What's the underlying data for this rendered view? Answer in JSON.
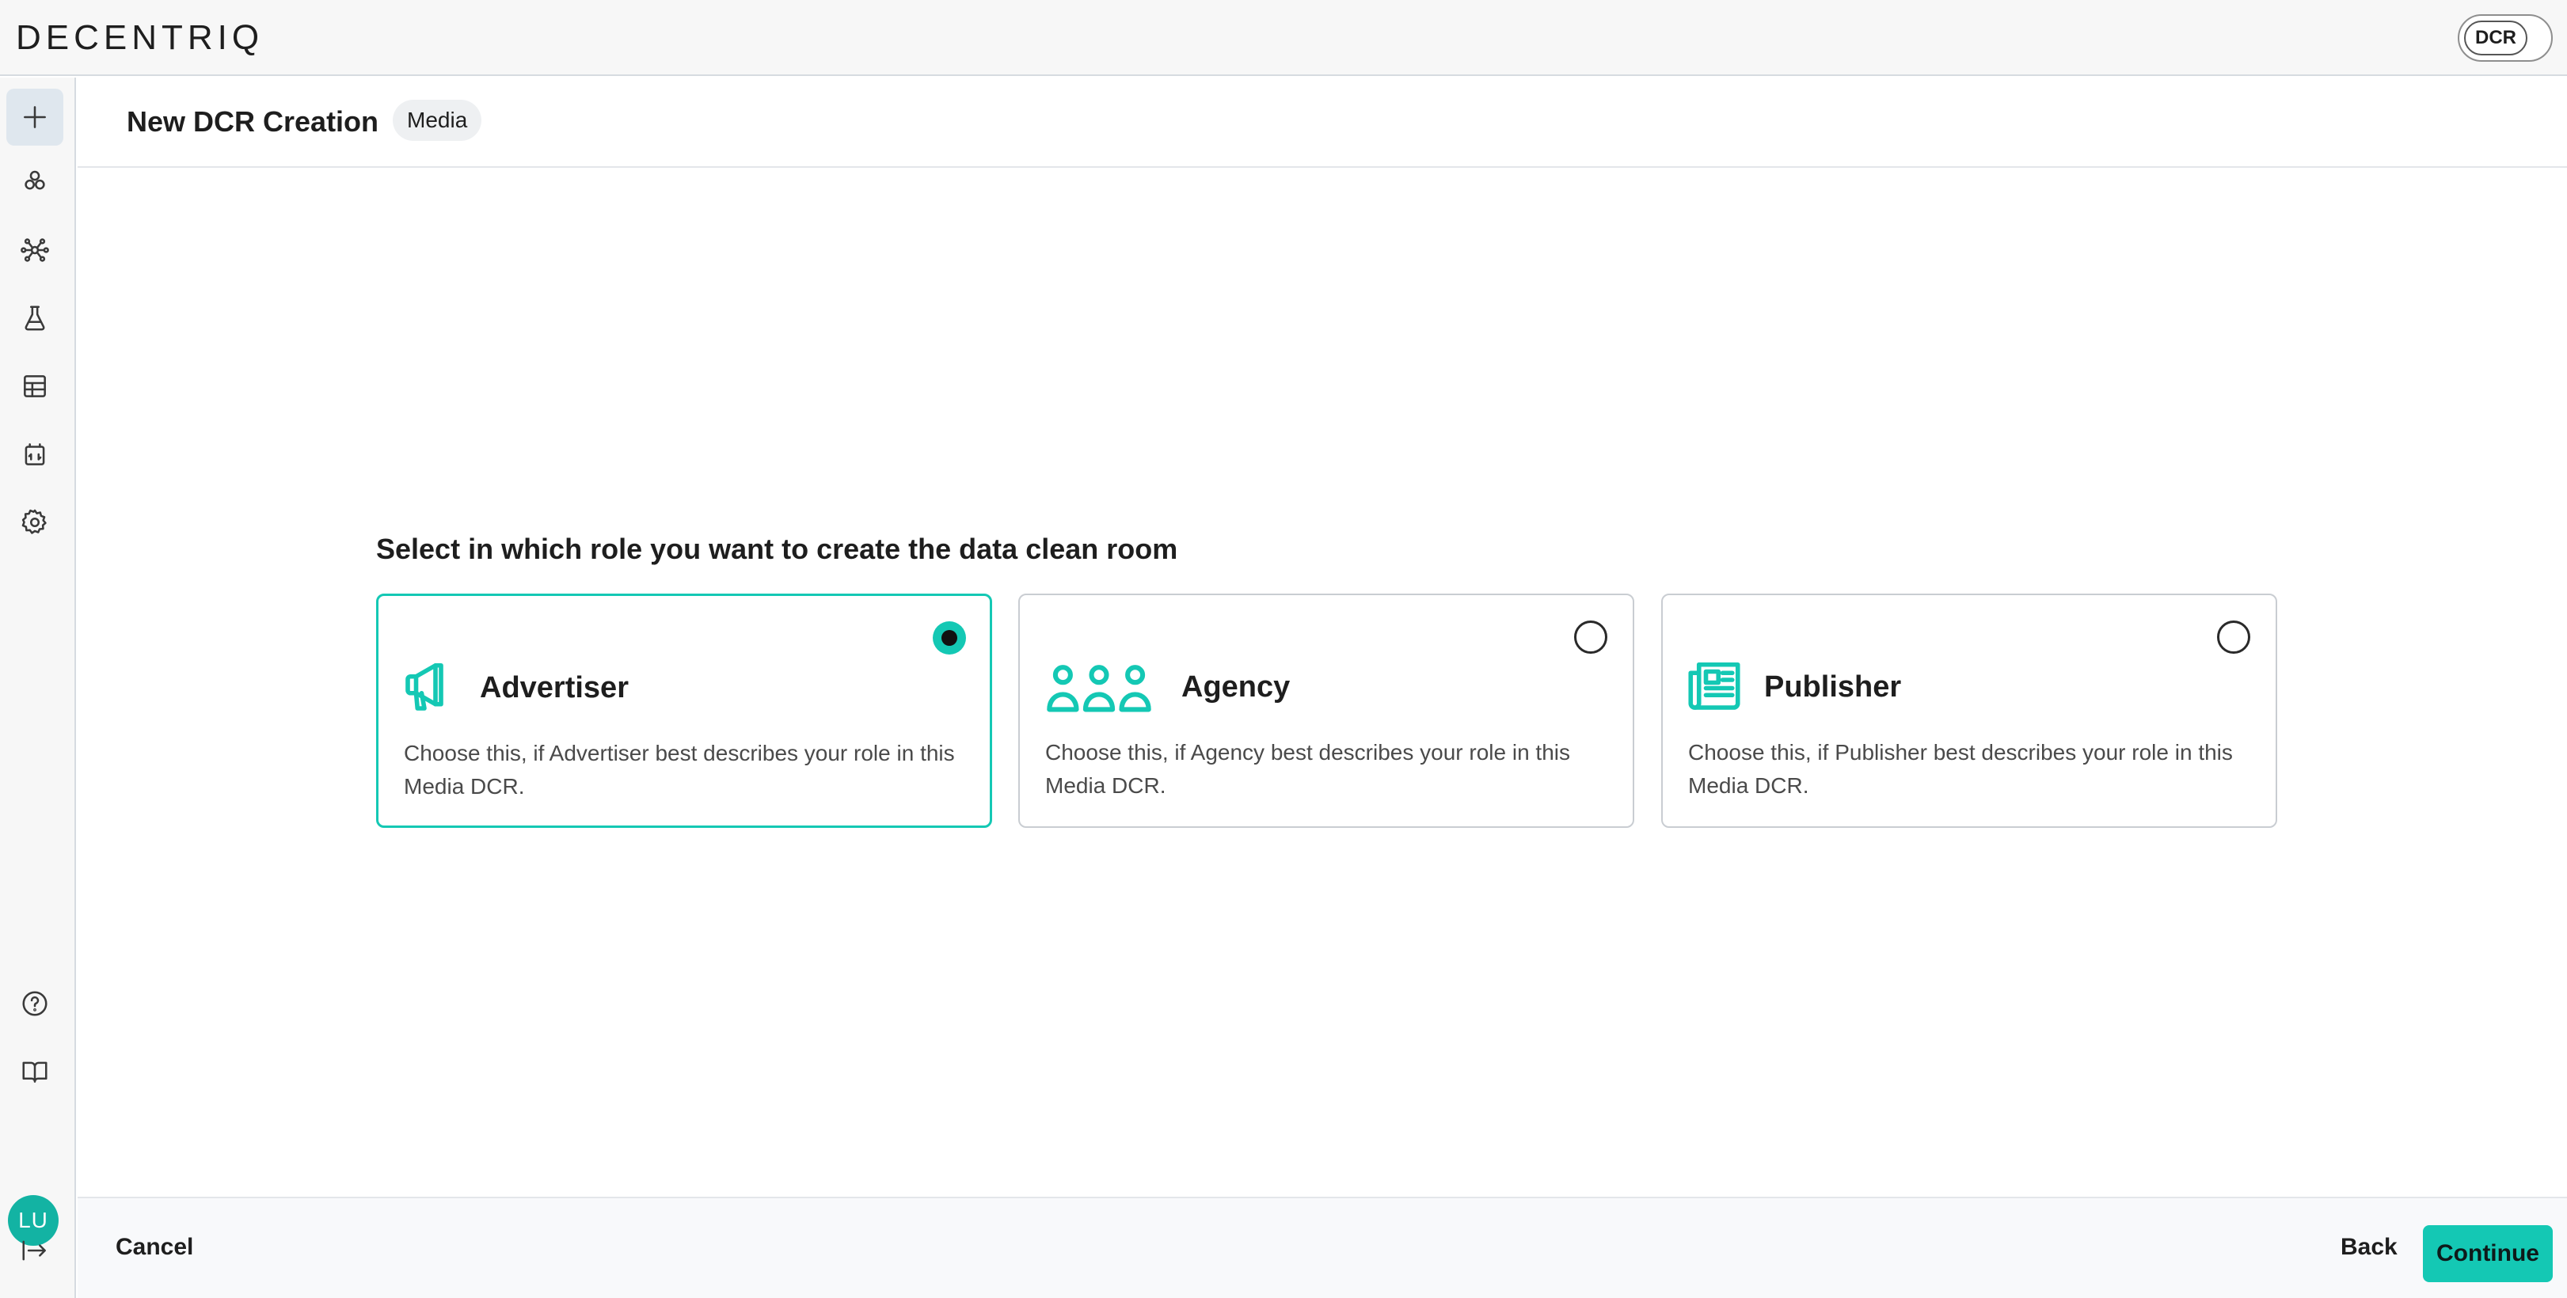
{
  "app": {
    "logo": "DECENTRIQ",
    "mode_toggle": "DCR"
  },
  "header": {
    "title": "New DCR Creation",
    "badge": "Media"
  },
  "main": {
    "prompt": "Select in which role you want to create the data clean room",
    "roles": [
      {
        "title": "Advertiser",
        "description": "Choose this, if Advertiser best describes your role in this Media DCR.",
        "selected": true,
        "icon": "megaphone-icon"
      },
      {
        "title": "Agency",
        "description": "Choose this, if Agency best describes your role in this Media DCR.",
        "selected": false,
        "icon": "people-group-icon"
      },
      {
        "title": "Publisher",
        "description": "Choose this, if Publisher best describes your role in this Media DCR.",
        "selected": false,
        "icon": "newspaper-icon"
      }
    ]
  },
  "sidebar": {
    "items": [
      "plus-icon",
      "datasets-icon",
      "network-icon",
      "flask-icon",
      "table-icon",
      "marketplace-icon",
      "settings-icon"
    ],
    "bottom_items": [
      "help-icon",
      "docs-book-icon"
    ],
    "avatar": "LU",
    "collapse": "expand-arrow-icon"
  },
  "footer": {
    "cancel_label": "Cancel",
    "back_label": "Back",
    "continue_label": "Continue"
  },
  "colors": {
    "accent": "#14c8b4",
    "avatar": "#13b3a3"
  }
}
